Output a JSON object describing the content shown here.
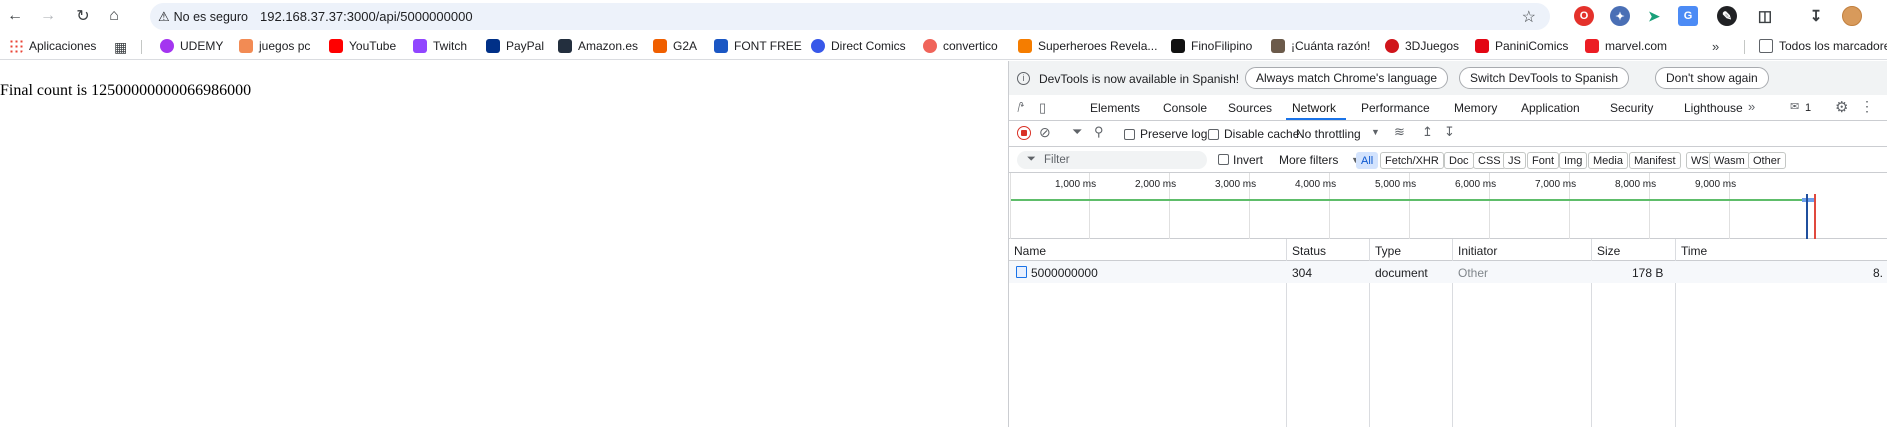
{
  "browser": {
    "security_label": "No es seguro",
    "url": "192.168.37.37:3000/api/5000000000"
  },
  "bookmarks": [
    {
      "label": "Aplicaciones"
    },
    {
      "label": "UDEMY"
    },
    {
      "label": "juegos pc"
    },
    {
      "label": "YouTube"
    },
    {
      "label": "Twitch"
    },
    {
      "label": "PayPal"
    },
    {
      "label": "Amazon.es"
    },
    {
      "label": "G2A"
    },
    {
      "label": "FONT FREE"
    },
    {
      "label": "Direct Comics"
    },
    {
      "label": "convertico"
    },
    {
      "label": "Superheroes Revela..."
    },
    {
      "label": "FinoFilipino"
    },
    {
      "label": "¡Cuánta razón!"
    },
    {
      "label": "3DJuegos"
    },
    {
      "label": "PaniniComics"
    },
    {
      "label": "marvel.com"
    },
    {
      "label": "Todos los marcadores"
    }
  ],
  "page": {
    "text": "Final count is 12500000000066986000"
  },
  "devtools": {
    "infobar": {
      "message": "DevTools is now available in Spanish!",
      "btn_match": "Always match Chrome's language",
      "btn_switch": "Switch DevTools to Spanish",
      "btn_dont": "Don't show again"
    },
    "tabs": [
      "Elements",
      "Console",
      "Sources",
      "Network",
      "Performance",
      "Memory",
      "Application",
      "Security",
      "Lighthouse"
    ],
    "active_tab": "Network",
    "issues_count": "1",
    "toolbar": {
      "preserve_log": "Preserve log",
      "disable_cache": "Disable cache",
      "throttling": "No throttling"
    },
    "filter": {
      "placeholder": "Filter",
      "invert": "Invert",
      "more_filters": "More filters",
      "chips": [
        "All",
        "Fetch/XHR",
        "Doc",
        "CSS",
        "JS",
        "Font",
        "Img",
        "Media",
        "Manifest",
        "WS",
        "Wasm",
        "Other"
      ],
      "selected": "All"
    },
    "timeline_ticks": [
      "1,000 ms",
      "2,000 ms",
      "3,000 ms",
      "4,000 ms",
      "5,000 ms",
      "6,000 ms",
      "7,000 ms",
      "8,000 ms",
      "9,000 ms"
    ],
    "columns": [
      "Name",
      "Status",
      "Type",
      "Initiator",
      "Size",
      "Time"
    ],
    "rows": [
      {
        "name": "5000000000",
        "status": "304",
        "type": "document",
        "initiator": "Other",
        "size": "178 B",
        "time": "8."
      }
    ]
  },
  "colors": {
    "accent": "#1a73e8",
    "record": "#d93025",
    "green_line": "#5ebd6a",
    "red_line": "#e0493e"
  }
}
